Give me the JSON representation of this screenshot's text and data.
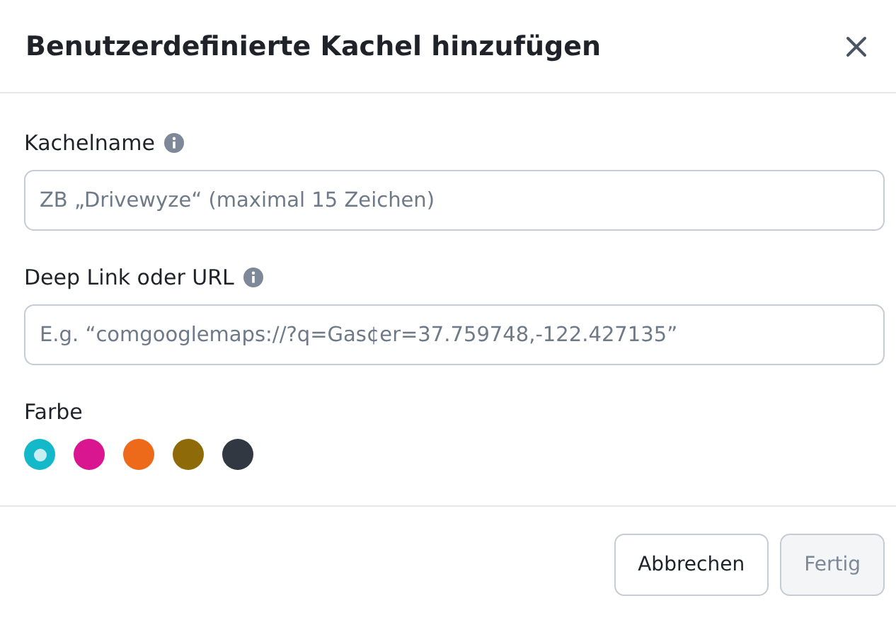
{
  "dialog": {
    "title": "Benutzerdefinierte Kachel hinzufügen"
  },
  "fields": [
    {
      "label": "Kachelname",
      "placeholder": "ZB „Drivewyze“ (maximal 15 Zeichen)"
    },
    {
      "label": "Deep Link oder URL",
      "placeholder": "E.g. “comgooglemaps://?q=Gas¢er=37.759748,-122.427135”"
    }
  ],
  "color_picker": {
    "label": "Farbe",
    "swatches": [
      {
        "color": "#13b8c9",
        "selected": true
      },
      {
        "color": "#d9168f",
        "selected": false
      },
      {
        "color": "#ee6a1b",
        "selected": false
      },
      {
        "color": "#8e6a08",
        "selected": false
      },
      {
        "color": "#323841",
        "selected": false
      }
    ]
  },
  "buttons": [
    {
      "label": "Abbrechen",
      "kind": "secondary",
      "disabled": false
    },
    {
      "label": "Fertig",
      "kind": "primary",
      "disabled": true
    }
  ]
}
